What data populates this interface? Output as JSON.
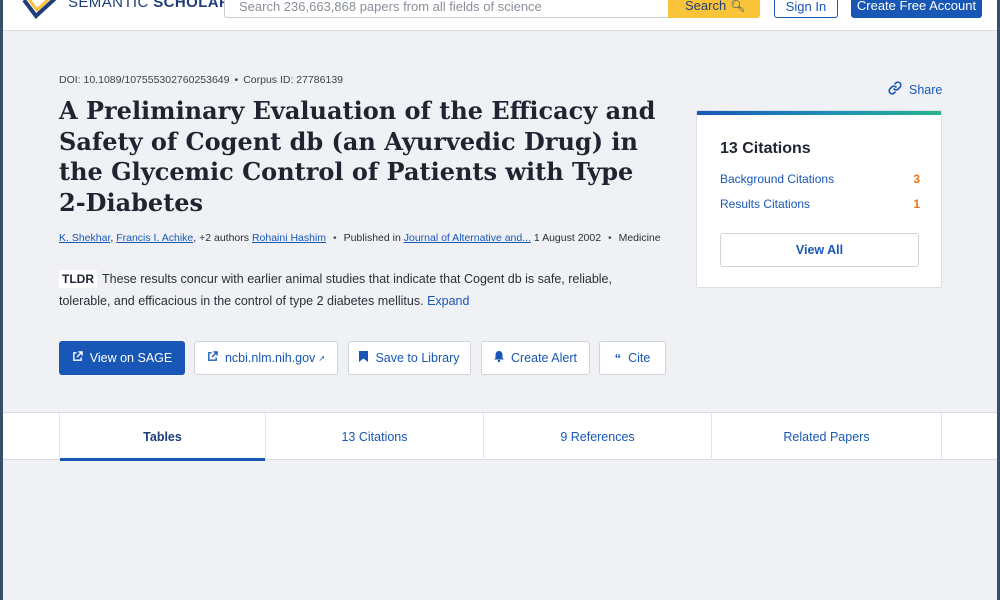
{
  "header": {
    "logo_text_light": "SEMANTIC ",
    "logo_text_bold": "SCHOLAR",
    "search_placeholder": "Search 236,663,868 papers from all fields of science",
    "search_button": "Search",
    "sign_in": "Sign In",
    "create_account": "Create Free Account"
  },
  "paper": {
    "doi": "DOI: 10.1089/107555302760253649",
    "corpus_id": "Corpus ID: 27786139",
    "title": "A Preliminary Evaluation of the Efficacy and Safety of Cogent db (an Ayurvedic Drug) in the Glycemic Control of Patients with Type 2-Diabetes",
    "authors": [
      "K. Shekhar",
      "Francis I. Achike"
    ],
    "more_authors": "+2 authors",
    "last_author": "Rohaini Hashim",
    "published_prefix": "Published in",
    "venue": "Journal of Alternative and...",
    "date": "1 August 2002",
    "field": "Medicine",
    "tldr_label": "TLDR",
    "tldr_text": "These results concur with earlier animal studies that indicate that Cogent db is safe, reliable, tolerable, and efficacious in the control of type 2 diabetes mellitus.",
    "tldr_expand": "Expand"
  },
  "actions": {
    "view_on": "View on SAGE",
    "ncbi": "ncbi.nlm.nih.gov",
    "save": "Save to Library",
    "alert": "Create Alert",
    "cite": "Cite"
  },
  "share": "Share",
  "citations_card": {
    "title": "13 Citations",
    "rows": [
      {
        "label": "Background Citations",
        "count": "3"
      },
      {
        "label": "Results Citations",
        "count": "1"
      }
    ],
    "view_all": "View All"
  },
  "tabs": [
    "Tables",
    "13 Citations",
    "9 References",
    "Related Papers"
  ],
  "colors": {
    "accent": "#1857b6",
    "search_button": "#fac43a",
    "citation_count": "#e8741c"
  }
}
